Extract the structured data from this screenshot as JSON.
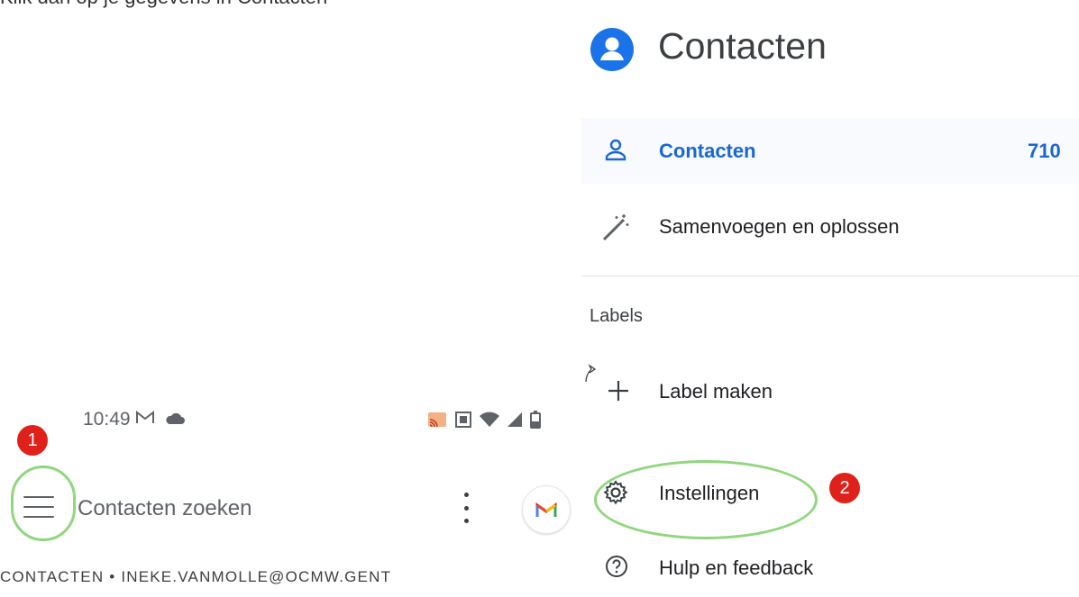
{
  "caption": {
    "text": "Klik dan op je gegevens in Contacten"
  },
  "phone": {
    "status_time": "10:49",
    "status_icons_left": [
      "gmail-status-icon",
      "cloud-icon"
    ],
    "status_icons_right": [
      "cast-icon",
      "sim-icon",
      "wifi-icon",
      "signal-icon",
      "battery-icon"
    ],
    "search_placeholder": "Contacten zoeken",
    "account_line": "CONTACTEN • INEKE.VANMOLLE@OCMW.GENT",
    "avatar_letter": "M"
  },
  "badges": {
    "first": "1",
    "second": "2"
  },
  "drawer": {
    "app_title": "Contacten",
    "items": {
      "contacts": {
        "label": "Contacten",
        "count": "710",
        "icon": "person-outline-icon"
      },
      "merge": {
        "label": "Samenvoegen en oplossen",
        "icon": "magic-wand-icon"
      },
      "labels_heading": "Labels",
      "create_label": {
        "label": "Label maken",
        "icon": "plus-icon"
      },
      "settings": {
        "label": "Instellingen",
        "icon": "gear-icon"
      },
      "help": {
        "label": "Hulp en feedback",
        "icon": "help-circle-icon"
      }
    }
  },
  "colors": {
    "accent": "#1967d2",
    "highlight_ring": "#8fd67e",
    "badge": "#e0211b",
    "active_bg": "#f8fafd"
  }
}
